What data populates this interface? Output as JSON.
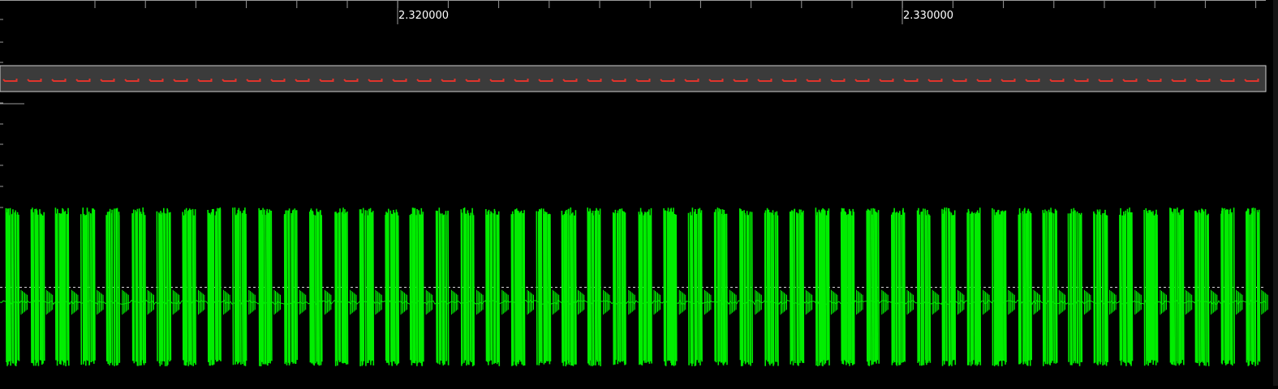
{
  "timeline": {
    "labels": [
      "2.320000",
      "2.330000"
    ]
  },
  "colors": {
    "background": "#000000",
    "ruler_ticks": "#9a9a9a",
    "digital_band": "#3b3b3b",
    "digital_band_border": "#cfcfcf",
    "digital_signal": "#e0342c",
    "analog_signal": "#00ee00",
    "threshold_line": "#d8d8d8"
  },
  "analog": {
    "burst_count": 50
  },
  "digital": {
    "pulse_count": 52
  }
}
